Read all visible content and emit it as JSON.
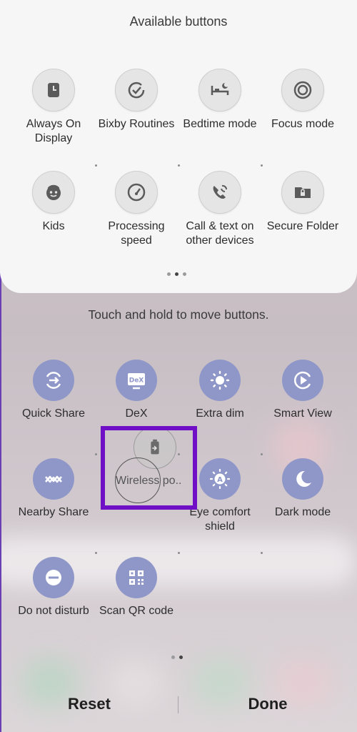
{
  "available": {
    "title": "Available buttons",
    "tiles": [
      {
        "label": "Always On Display",
        "icon": "clock-icon"
      },
      {
        "label": "Bixby Routines",
        "icon": "routine-check-icon"
      },
      {
        "label": "Bedtime mode",
        "icon": "bed-icon"
      },
      {
        "label": "Focus mode",
        "icon": "target-icon"
      },
      {
        "label": "Kids",
        "icon": "kids-face-icon"
      },
      {
        "label": "Processing speed",
        "icon": "speedometer-icon"
      },
      {
        "label": "Call & text on other devices",
        "icon": "phone-sync-icon"
      },
      {
        "label": "Secure Folder",
        "icon": "lock-folder-icon"
      }
    ]
  },
  "hint": "Touch and hold to move buttons.",
  "active": {
    "tiles": [
      {
        "label": "Quick Share",
        "icon": "quick-share-icon"
      },
      {
        "label": "DeX",
        "icon": "dex-icon",
        "icon_text": "DeX"
      },
      {
        "label": "Extra dim",
        "icon": "extra-dim-icon"
      },
      {
        "label": "Smart View",
        "icon": "smart-view-icon"
      },
      {
        "label": "Nearby Share",
        "icon": "nearby-share-icon"
      },
      {
        "label": "Eye comfort shield",
        "icon": "eye-comfort-icon",
        "icon_text": "A"
      },
      {
        "label": "Dark mode",
        "icon": "moon-icon"
      },
      {
        "label": "Do not disturb",
        "icon": "do-not-disturb-icon"
      },
      {
        "label": "Scan QR code",
        "icon": "qr-code-icon"
      }
    ]
  },
  "dragging": {
    "label": "Wireless po..",
    "icon": "battery-share-icon"
  },
  "footer": {
    "reset": "Reset",
    "done": "Done"
  },
  "colors": {
    "accent": "#7010c6",
    "active_tile": "#8f97c9",
    "panel": "#f7f6f6"
  }
}
